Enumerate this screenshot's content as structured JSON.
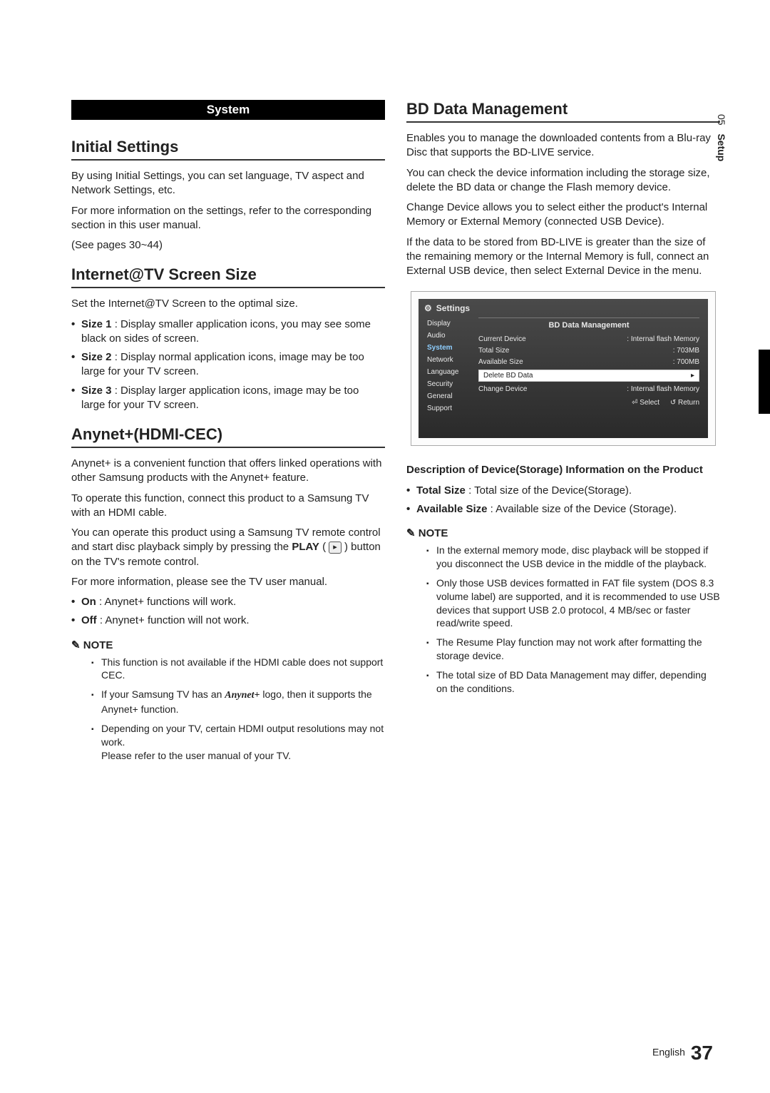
{
  "sideTab": {
    "num": "05",
    "label": "Setup"
  },
  "systemBar": "System",
  "sections": {
    "initial": {
      "title": "Initial Settings",
      "p1": "By using Initial Settings, you can set language, TV aspect and Network Settings, etc.",
      "p2": "For more information on the settings, refer to the corresponding section in this user manual.",
      "p3": "(See pages 30~44)"
    },
    "itv": {
      "title": "Internet@TV Screen Size",
      "intro": "Set the Internet@TV Screen to the optimal size.",
      "items": [
        {
          "label": "Size 1",
          "text": " : Display smaller application icons, you may see some black on sides of screen."
        },
        {
          "label": "Size 2",
          "text": " : Display normal application icons, image may be too large for your TV screen."
        },
        {
          "label": "Size 3",
          "text": " : Display larger application icons, image may be too large for your TV screen."
        }
      ]
    },
    "anynet": {
      "title": "Anynet+(HDMI-CEC)",
      "p1": "Anynet+ is a convenient function that offers linked operations with other Samsung products with the Anynet+ feature.",
      "p2": "To operate this function, connect this product to a Samsung TV with an HDMI cable.",
      "p3a": "You can operate this product using a Samsung TV remote control and start disc playback simply by pressing the ",
      "play": "PLAY",
      "p3b": " button on the TV's remote control.",
      "p4": "For more information, please see the TV user manual.",
      "opts": [
        {
          "label": "On",
          "text": " : Anynet+ functions will work."
        },
        {
          "label": "Off",
          "text": " : Anynet+ function will not work."
        }
      ],
      "noteHead": "NOTE",
      "notes": {
        "n1": "This function is not available if the HDMI cable does not support CEC.",
        "n2a": "If your Samsung TV has an ",
        "n2logo": "Anynet+",
        "n2b": " logo, then it supports the Anynet+ function.",
        "n3a": "Depending on your TV, certain HDMI output resolutions may not work.",
        "n3b": "Please refer to the user manual of your TV."
      }
    },
    "bd": {
      "title": "BD Data Management",
      "p1": "Enables you to manage the downloaded contents from a Blu-ray Disc that supports the BD-LIVE service.",
      "p2": "You can check the device information including the storage size, delete the BD data or change the Flash memory device.",
      "p3": "Change Device allows you to select either the product's Internal Memory or External Memory (connected USB Device).",
      "p4": "If the data to be stored from BD-LIVE is greater than the size of the remaining memory or the Internal Memory is full, connect an External USB device, then select External Device in the menu."
    },
    "panel": {
      "title": "Settings",
      "menu": [
        "Display",
        "Audio",
        "System",
        "Network",
        "Language",
        "Security",
        "General",
        "Support"
      ],
      "activeIndex": 2,
      "head": "BD Data Management",
      "rows": {
        "currentDeviceLabel": "Current Device",
        "currentDeviceVal": ": Internal flash Memory",
        "totalSizeLabel": "Total Size",
        "totalSizeVal": ": 703MB",
        "availLabel": "Available Size",
        "availVal": ": 700MB",
        "deleteLabel": "Delete BD Data",
        "deleteArrow": "▸",
        "changeLabel": "Change Device",
        "changeVal": ": Internal flash Memory"
      },
      "hints": {
        "select": "⏎ Select",
        "return": "↺ Return"
      }
    },
    "desc": {
      "head": "Description of Device(Storage) Information on the Product",
      "items": [
        {
          "label": "Total Size",
          "text": " : Total size of the Device(Storage)."
        },
        {
          "label": "Available Size",
          "text": " : Available size of the Device (Storage)."
        }
      ],
      "noteHead": "NOTE",
      "notes": [
        "In the external memory mode, disc playback will be stopped if you disconnect the USB device in the middle of the playback.",
        "Only those USB devices formatted in FAT file system (DOS 8.3 volume label) are supported, and it is recommended to use USB devices that support USB 2.0 protocol, 4 MB/sec or faster read/write speed.",
        "The Resume Play function may not work after formatting the storage device.",
        "The total size of BD Data Management may differ, depending on the conditions."
      ]
    }
  },
  "footer": {
    "lang": "English",
    "page": "37"
  }
}
